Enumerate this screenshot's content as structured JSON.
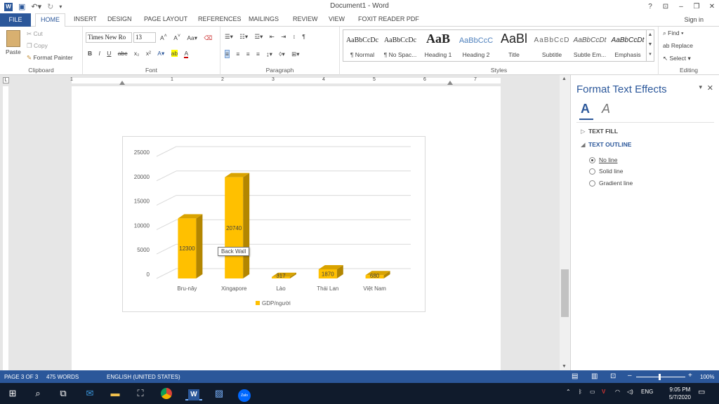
{
  "window": {
    "title": "Document1 - Word",
    "signin": "Sign in",
    "help": "?",
    "ribbon_toggle": "⊡",
    "minimize": "–",
    "restore": "❐",
    "close": "✕"
  },
  "tabs": [
    "FILE",
    "HOME",
    "INSERT",
    "DESIGN",
    "PAGE LAYOUT",
    "REFERENCES",
    "MAILINGS",
    "REVIEW",
    "VIEW",
    "FOXIT READER PDF"
  ],
  "ribbon": {
    "clipboard": {
      "label": "Clipboard",
      "paste": "Paste",
      "cut": "Cut",
      "copy": "Copy",
      "format_painter": "Format Painter"
    },
    "font": {
      "label": "Font",
      "font_name": "Times New Ro",
      "font_size": "13"
    },
    "paragraph": {
      "label": "Paragraph"
    },
    "styles": {
      "label": "Styles",
      "items": [
        {
          "sample": "AaBbCcDc",
          "name": "¶ Normal"
        },
        {
          "sample": "AaBbCcDc",
          "name": "¶ No Spac..."
        },
        {
          "sample": "AaB",
          "name": "Heading 1"
        },
        {
          "sample": "AaBbCcC",
          "name": "Heading 2"
        },
        {
          "sample": "AaBl",
          "name": "Title"
        },
        {
          "sample": "AaBbCcD",
          "name": "Subtitle"
        },
        {
          "sample": "AaBbCcDt",
          "name": "Subtle Em..."
        },
        {
          "sample": "AaBbCcDt",
          "name": "Emphasis"
        }
      ]
    },
    "editing": {
      "label": "Editing",
      "find": "Find",
      "replace": "Replace",
      "select": "Select"
    }
  },
  "ruler": {
    "numbers": [
      "1",
      "1",
      "2",
      "3",
      "4",
      "5",
      "6",
      "7"
    ]
  },
  "chart_data": {
    "type": "bar",
    "categories": [
      "Bru-nây",
      "Xingapore",
      "Lào",
      "Thái Lan",
      "Việt Nam"
    ],
    "series": [
      {
        "name": "GDP/người",
        "values": [
          12300,
          20740,
          317,
          1870,
          680
        ]
      }
    ],
    "ylim": [
      0,
      25000
    ],
    "yticks": [
      "0",
      "5000",
      "10000",
      "15000",
      "20000",
      "25000"
    ],
    "data_labels": [
      "12300",
      "20740",
      "317",
      "1870",
      "680"
    ],
    "legend": "bottom",
    "grid": true,
    "bar_color": "#ffc000",
    "style": "3d"
  },
  "tooltip": "Back Wall",
  "pane": {
    "title": "Format Text Effects",
    "sections": {
      "fill": "TEXT FILL",
      "outline": "TEXT OUTLINE"
    },
    "options": [
      "No line",
      "Solid line",
      "Gradient line"
    ],
    "selected_option": 0
  },
  "status": {
    "page": "PAGE 3 OF 3",
    "words": "475 WORDS",
    "language": "ENGLISH (UNITED STATES)",
    "zoom": "100%"
  },
  "taskbar": {
    "time": "9:05 PM",
    "date": "5/7/2020",
    "lang": "ENG",
    "zalo": "Zalo"
  },
  "colors": {
    "accent": "#2b579a",
    "bar": "#ffc000"
  }
}
